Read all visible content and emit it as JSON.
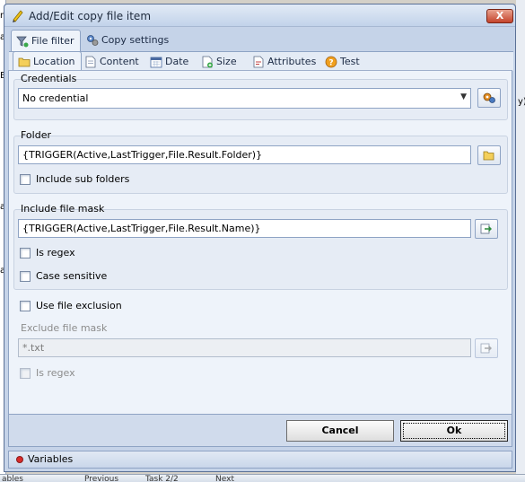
{
  "window": {
    "title": "Add/Edit copy file item",
    "close_label": "X"
  },
  "tabs_primary": [
    {
      "label": "File filter",
      "icon": "funnel-icon",
      "active": true
    },
    {
      "label": "Copy settings",
      "icon": "gears-icon",
      "active": false
    }
  ],
  "tabs_secondary": [
    {
      "label": "Location",
      "icon": "folder-icon",
      "active": true
    },
    {
      "label": "Content",
      "icon": "document-icon",
      "active": false
    },
    {
      "label": "Date",
      "icon": "calendar-icon",
      "active": false
    },
    {
      "label": "Size",
      "icon": "size-icon",
      "active": false
    },
    {
      "label": "Attributes",
      "icon": "attributes-icon",
      "active": false
    },
    {
      "label": "Test",
      "icon": "help-icon",
      "active": false
    }
  ],
  "credentials": {
    "title": "Credentials",
    "selected": "No credential"
  },
  "folder": {
    "title": "Folder",
    "value": "{TRIGGER(Active,LastTrigger,File.Result.Folder)}",
    "include_sub_folders": {
      "label": "Include sub folders",
      "checked": false
    }
  },
  "include_mask": {
    "title": "Include file mask",
    "value": "{TRIGGER(Active,LastTrigger,File.Result.Name)}",
    "is_regex": {
      "label": "Is regex",
      "checked": false
    },
    "case_sensitive": {
      "label": "Case sensitive",
      "checked": false
    }
  },
  "use_file_exclusion": {
    "label": "Use file exclusion",
    "checked": false
  },
  "exclude_mask": {
    "title": "Exclude file mask",
    "value": "*.txt",
    "is_regex": {
      "label": "Is regex",
      "checked": false
    }
  },
  "buttons": {
    "cancel": "Cancel",
    "ok": "Ok"
  },
  "statusbar": {
    "variables": "Variables"
  },
  "background": {
    "left_letters": [
      "n",
      "a",
      "E",
      "a",
      "a"
    ],
    "right_letter": "y)",
    "bottom_bar": {
      "left": "ables",
      "prev": "Previous",
      "task": "Task 2/2",
      "next": "Next"
    }
  },
  "colors": {
    "accent": "#8ea3c4",
    "titlebar": "#c2d3ea",
    "close": "#c4432b"
  }
}
